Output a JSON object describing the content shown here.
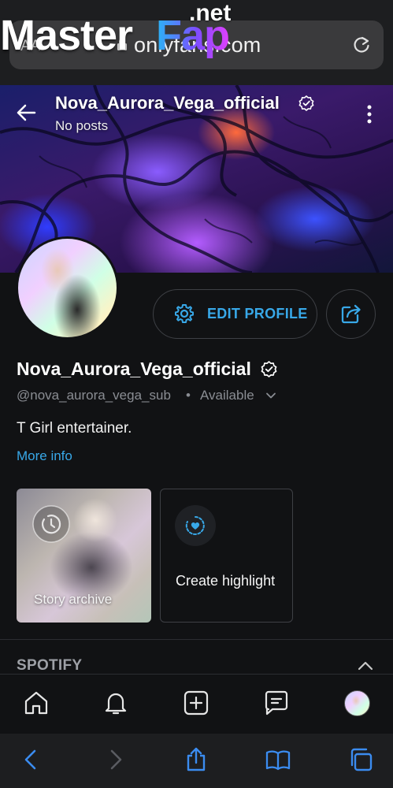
{
  "browser": {
    "aa_label": "AA",
    "url": "onlyfans.com",
    "watermark": {
      "master": "Master",
      "fap": "Fap",
      "net": ".net"
    }
  },
  "cover": {
    "name": "Nova_Aurora_Vega_official",
    "posts": "No posts"
  },
  "profile": {
    "edit_label": "EDIT PROFILE",
    "name": "Nova_Aurora_Vega_official",
    "handle": "@nova_aurora_vega_sub",
    "separator": "•",
    "status": "Available",
    "bio": "T Girl entertainer.",
    "more_info": "More info"
  },
  "highlights": {
    "story_archive": "Story archive",
    "create_highlight": "Create highlight"
  },
  "sections": {
    "spotify": "SPOTIFY"
  },
  "colors": {
    "accent": "#38a8e8",
    "background": "#111214",
    "browser_chrome": "#1d1e20",
    "muted_text": "#8a8d93"
  },
  "icons": {
    "app_nav": [
      "home-icon",
      "bell-icon",
      "add-post-icon",
      "messages-icon",
      "profile-avatar"
    ],
    "browser_toolbar": [
      "back-icon",
      "forward-icon",
      "share-icon",
      "bookmarks-icon",
      "tabs-icon"
    ]
  }
}
